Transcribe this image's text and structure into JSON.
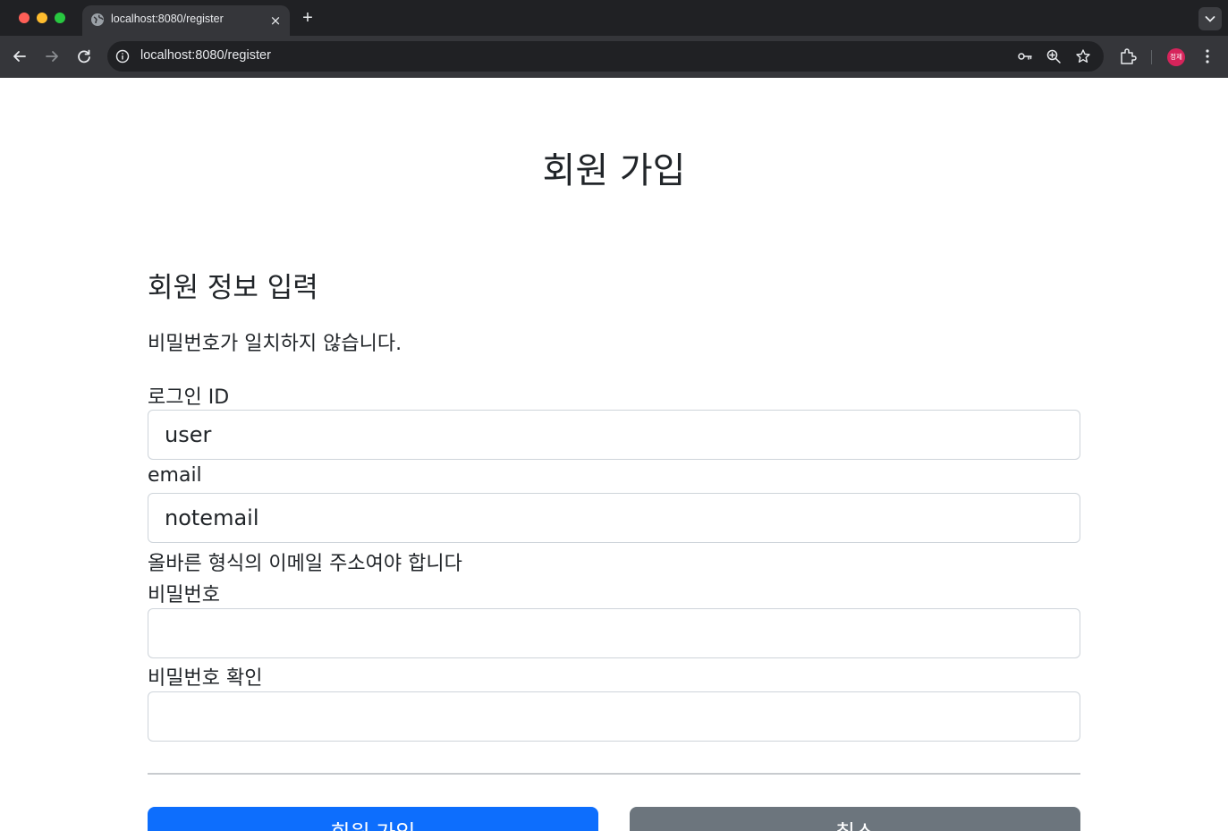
{
  "browser": {
    "tab_title": "localhost:8080/register",
    "tab_close": "×",
    "new_tab": "+",
    "url": "localhost:8080/register",
    "profile_initials": "정제",
    "profile_color": "#d6245b"
  },
  "page": {
    "title": "회원 가입",
    "section_title": "회원 정보 입력",
    "global_error": "비밀번호가 일치하지 않습니다."
  },
  "form": {
    "login_id": {
      "label": "로그인 ID",
      "value": "user"
    },
    "email": {
      "label": "email",
      "value": "notemail",
      "error": "올바른 형식의 이메일 주소여야 합니다"
    },
    "password": {
      "label": "비밀번호",
      "value": ""
    },
    "password_confirm": {
      "label": "비밀번호 확인",
      "value": ""
    }
  },
  "buttons": {
    "submit": "회원 가입",
    "cancel": "취소"
  },
  "colors": {
    "primary": "#0d6efd",
    "secondary": "#6c757d"
  }
}
